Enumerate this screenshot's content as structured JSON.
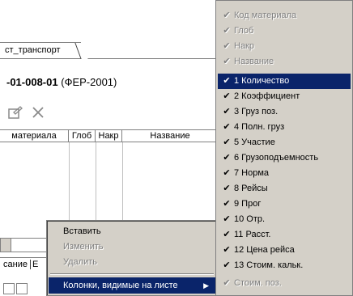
{
  "window": {
    "tab_label": "ст_транспорт",
    "doc_code": "-01-008-01",
    "doc_source": "(ФЕР-2001)"
  },
  "toolbar": {
    "icons": [
      "properties-icon",
      "close-icon"
    ]
  },
  "grid": {
    "columns": [
      "материала",
      "Глоб",
      "Накр",
      "Название"
    ]
  },
  "sheet_tabs": {
    "label": "сание",
    "partial": "Е"
  },
  "context_menu": {
    "items": [
      {
        "label": "Вставить",
        "enabled": true
      },
      {
        "label": "Изменить",
        "enabled": false
      },
      {
        "label": "Удалить",
        "enabled": false
      },
      {
        "label": "Колонки, видимые на листе",
        "enabled": true,
        "highlight": true,
        "has_submenu": true
      }
    ]
  },
  "columns_submenu": {
    "items": [
      {
        "label": "Код материала",
        "checked": true,
        "enabled": false
      },
      {
        "label": "Глоб",
        "checked": true,
        "enabled": false
      },
      {
        "label": "Накр",
        "checked": true,
        "enabled": false
      },
      {
        "label": "Название",
        "checked": true,
        "enabled": false
      },
      {
        "label": "1 Количество",
        "checked": true,
        "enabled": true,
        "highlight": true
      },
      {
        "label": "2 Коэффициент",
        "checked": true,
        "enabled": true
      },
      {
        "label": "3 Груз поз.",
        "checked": true,
        "enabled": true
      },
      {
        "label": "4 Полн. груз",
        "checked": true,
        "enabled": true
      },
      {
        "label": "5 Участие",
        "checked": true,
        "enabled": true
      },
      {
        "label": "6 Грузоподъемность",
        "checked": true,
        "enabled": true
      },
      {
        "label": "7 Норма",
        "checked": true,
        "enabled": true
      },
      {
        "label": "8 Рейсы",
        "checked": true,
        "enabled": true
      },
      {
        "label": "9 Прог",
        "checked": true,
        "enabled": true
      },
      {
        "label": "10 Отр.",
        "checked": true,
        "enabled": true
      },
      {
        "label": "11 Расст.",
        "checked": true,
        "enabled": true
      },
      {
        "label": "12 Цена рейса",
        "checked": true,
        "enabled": true
      },
      {
        "label": "13 Стоим. кальк.",
        "checked": true,
        "enabled": true
      },
      {
        "label": "Стоим. поз.",
        "checked": true,
        "enabled": false
      }
    ]
  },
  "colors": {
    "menu_bg": "#d4d0c8",
    "highlight": "#0a246a",
    "disabled_text": "#808080"
  }
}
